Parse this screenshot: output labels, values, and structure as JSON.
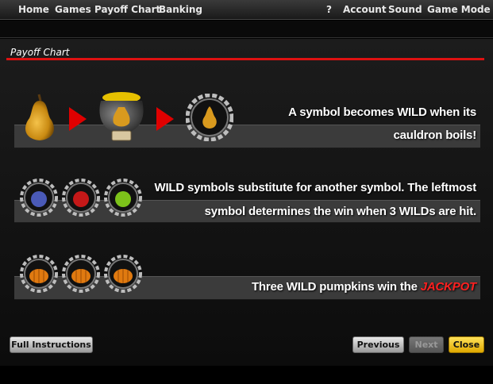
{
  "nav": {
    "home": "Home",
    "games": "Games",
    "payoff_chart": "Payoff Chart",
    "banking": "Banking",
    "help": "?",
    "account": "Account",
    "sound": "Sound",
    "game_mode": "Game Mode"
  },
  "panel": {
    "title": "Payoff Chart"
  },
  "rows": [
    {
      "line1": "A symbol becomes WILD when its",
      "line2": "cauldron boils!",
      "icons": [
        "pear-icon",
        "arrow-right-icon",
        "cauldron-pear-icon",
        "arrow-right-icon",
        "wild-pear-icon"
      ]
    },
    {
      "line1": "WILD symbols substitute for another symbol. The leftmost",
      "line2": "symbol determines the win when 3 WILDs are hit.",
      "icons": [
        "wild-plum-icon",
        "wild-apple-icon",
        "wild-lime-icon"
      ]
    },
    {
      "line1_prefix": "Three WILD pumpkins win the ",
      "line1_highlight": "JACKPOT",
      "icons": [
        "wild-pumpkin-icon",
        "wild-pumpkin-icon",
        "wild-pumpkin-icon"
      ]
    }
  ],
  "buttons": {
    "full_instructions": "Full Instructions",
    "previous": "Previous",
    "next": "Next",
    "close": "Close"
  },
  "colors": {
    "accent_red": "#d11111",
    "jackpot_red": "#ff2020",
    "close_yellow": "#f5c400",
    "bar_gray": "#3b3b3b"
  }
}
